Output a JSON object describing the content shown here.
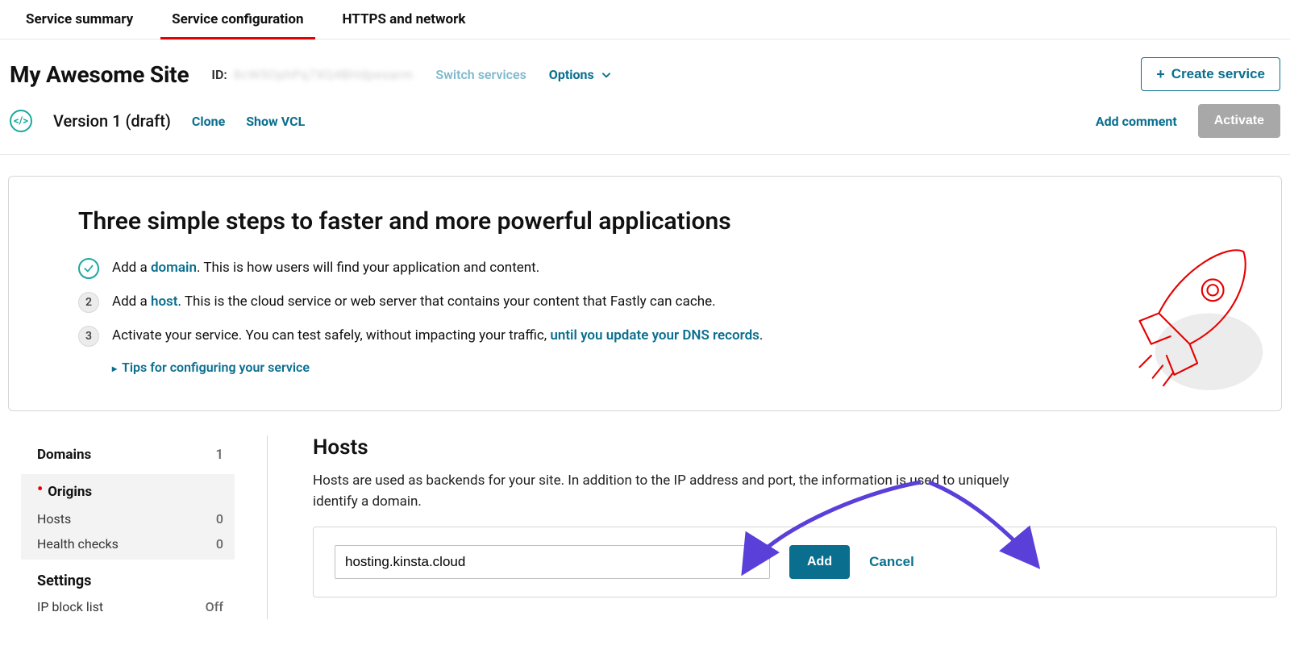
{
  "tabs": {
    "summary": "Service summary",
    "config": "Service configuration",
    "https": "HTTPS and network"
  },
  "header": {
    "site_title": "My Awesome Site",
    "id_label": "ID:",
    "id_value": "8cW5OphPq7XQ4BHdpesarm",
    "switch_services": "Switch services",
    "options": "Options",
    "create_service": "Create service"
  },
  "version": {
    "label": "Version 1 (draft)",
    "clone": "Clone",
    "show_vcl": "Show VCL",
    "add_comment": "Add comment",
    "activate": "Activate"
  },
  "onboard": {
    "title": "Three simple steps to faster and more powerful applications",
    "step1_a": "Add a ",
    "step1_link": "domain",
    "step1_b": ". This is how users will find your application and content.",
    "step2_a": "Add a ",
    "step2_link": "host",
    "step2_b": ". This is the cloud service or web server that contains your content that Fastly can cache.",
    "step2_num": "2",
    "step3_a": "Activate your service. You can test safely, without impacting your traffic, ",
    "step3_link": "until you update your DNS records",
    "step3_b": ".",
    "step3_num": "3",
    "tips": "Tips for configuring your service"
  },
  "sidenav": {
    "domains_label": "Domains",
    "domains_count": "1",
    "origins_label": "Origins",
    "hosts_label": "Hosts",
    "hosts_count": "0",
    "health_label": "Health checks",
    "health_count": "0",
    "settings_label": "Settings",
    "ipblock_label": "IP block list",
    "ipblock_value": "Off"
  },
  "hosts_section": {
    "title": "Hosts",
    "desc": "Hosts are used as backends for your site. In addition to the IP address and port, the information is used to uniquely identify a domain.",
    "input_value": "hosting.kinsta.cloud",
    "add": "Add",
    "cancel": "Cancel"
  }
}
